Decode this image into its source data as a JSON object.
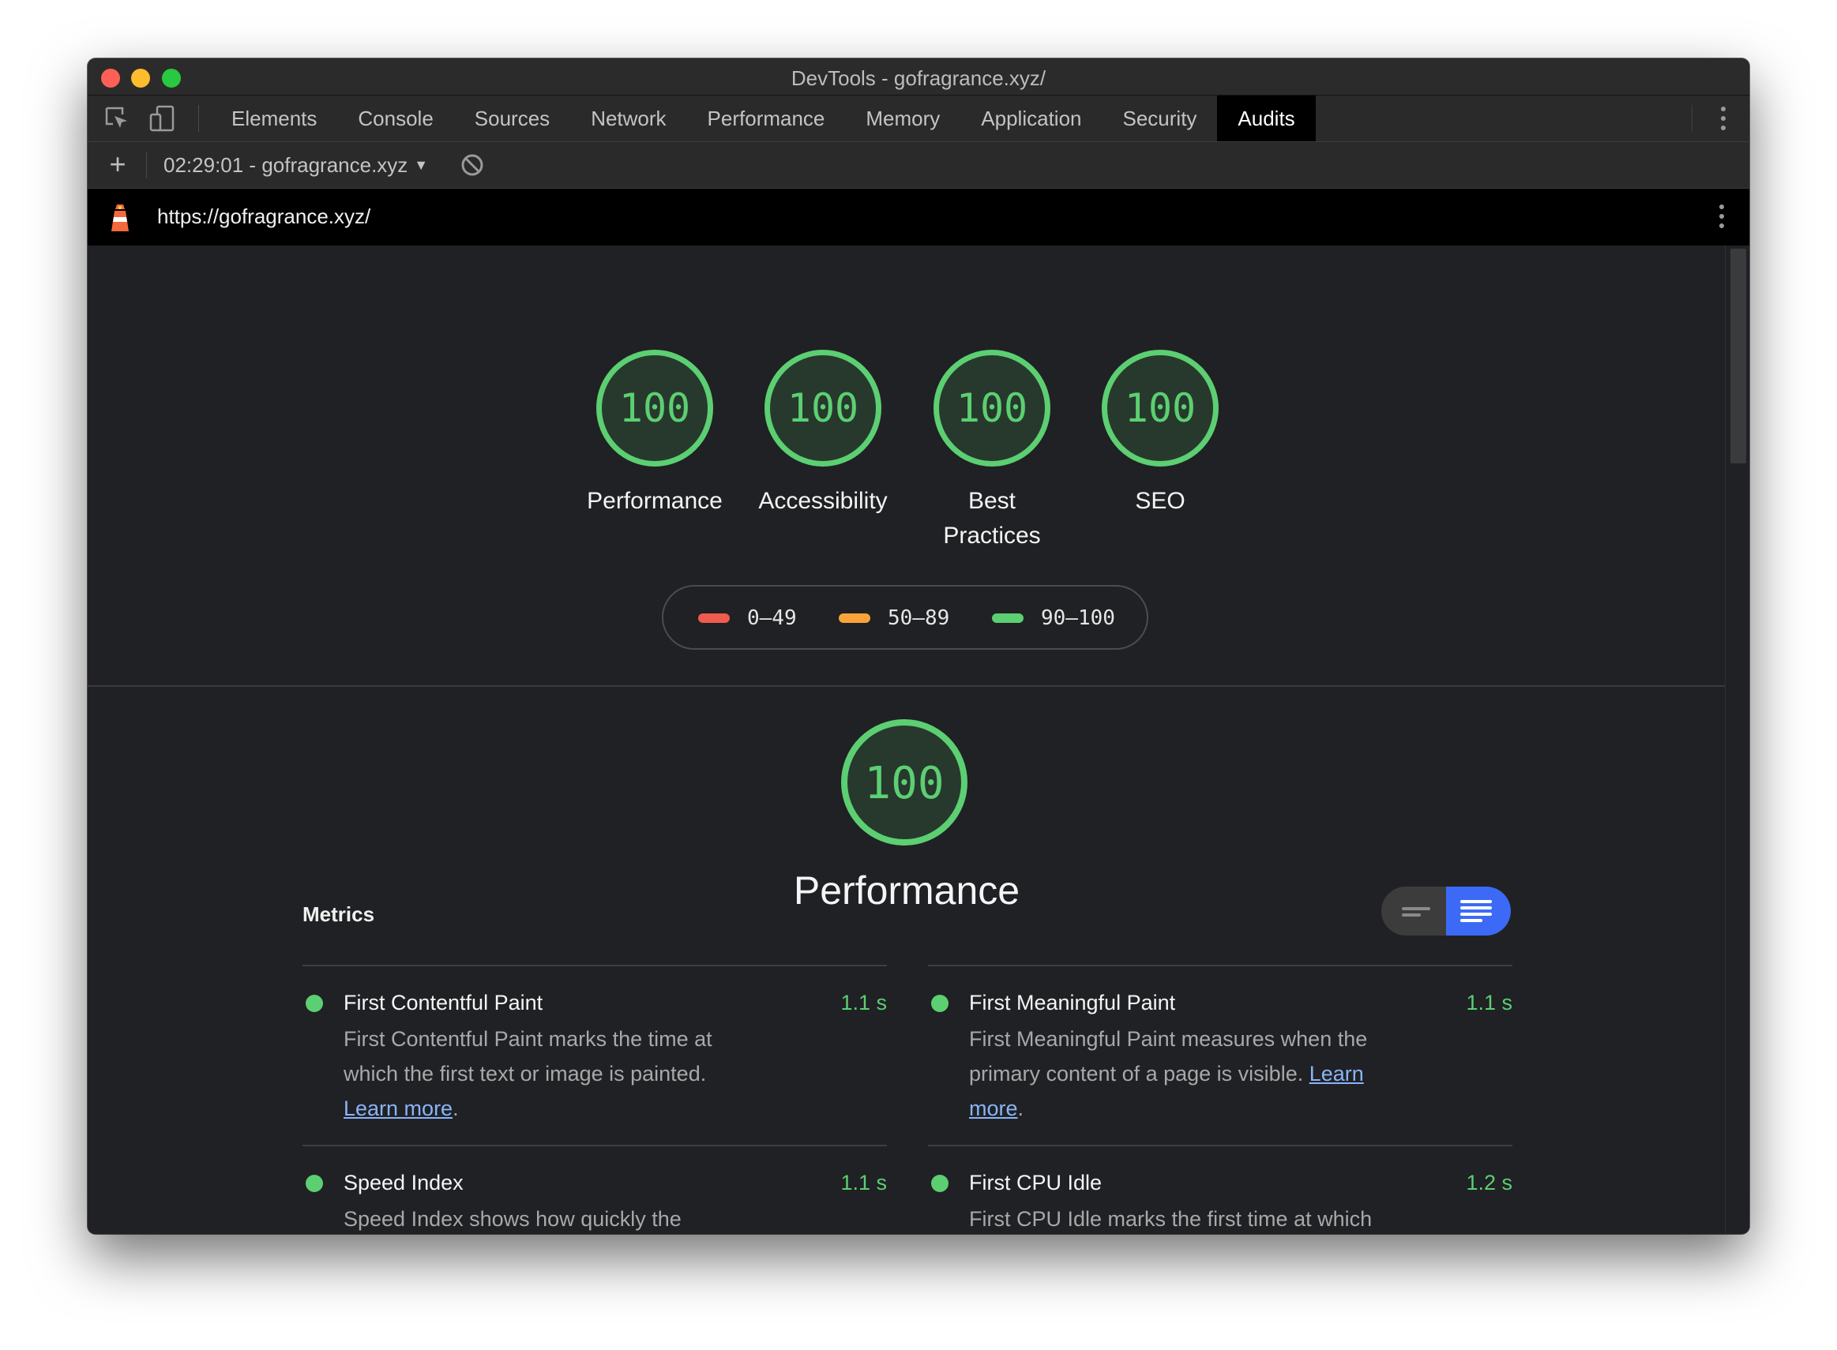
{
  "window": {
    "title": "DevTools - gofragrance.xyz/"
  },
  "tabs": [
    {
      "label": "Elements"
    },
    {
      "label": "Console"
    },
    {
      "label": "Sources"
    },
    {
      "label": "Network"
    },
    {
      "label": "Performance"
    },
    {
      "label": "Memory"
    },
    {
      "label": "Application"
    },
    {
      "label": "Security"
    },
    {
      "label": "Audits",
      "active": true
    }
  ],
  "report": {
    "selected": "02:29:01 - gofragrance.xyz",
    "url": "https://gofragrance.xyz/"
  },
  "gauges": [
    {
      "score": "100",
      "label": "Performance"
    },
    {
      "score": "100",
      "label": "Accessibility"
    },
    {
      "score": "100",
      "label": "Best Practices"
    },
    {
      "score": "100",
      "label": "SEO"
    }
  ],
  "legend": [
    {
      "range": "0–49",
      "color": "#f05b4f"
    },
    {
      "range": "50–89",
      "color": "#f9a43a"
    },
    {
      "range": "90–100",
      "color": "#5ccf72"
    }
  ],
  "category": {
    "score": "100",
    "title": "Performance",
    "metrics_heading": "Metrics"
  },
  "metrics": [
    {
      "name": "First Contentful Paint",
      "value": "1.1 s",
      "desc": "First Contentful Paint marks the time at which the first text or image is painted.",
      "link": "Learn more",
      "tail": "."
    },
    {
      "name": "First Meaningful Paint",
      "value": "1.1 s",
      "desc": "First Meaningful Paint measures when the primary content of a page is visible.",
      "link": "Learn more",
      "tail": "."
    },
    {
      "name": "Speed Index",
      "value": "1.1 s",
      "desc": "Speed Index shows how quickly the contents of a page are visibly populated.",
      "link": "",
      "tail": ""
    },
    {
      "name": "First CPU Idle",
      "value": "1.2 s",
      "desc": "First CPU Idle marks the first time at which the page's main thread is quiet enough to",
      "link": "",
      "tail": ""
    }
  ],
  "colors": {
    "pass": "#5ccf72",
    "toggle_active": "#3c6af7"
  },
  "icons": [
    "inspect-icon",
    "device-toggle-icon",
    "add-icon",
    "clear-icon",
    "lighthouse-icon",
    "more-vert-icon"
  ]
}
